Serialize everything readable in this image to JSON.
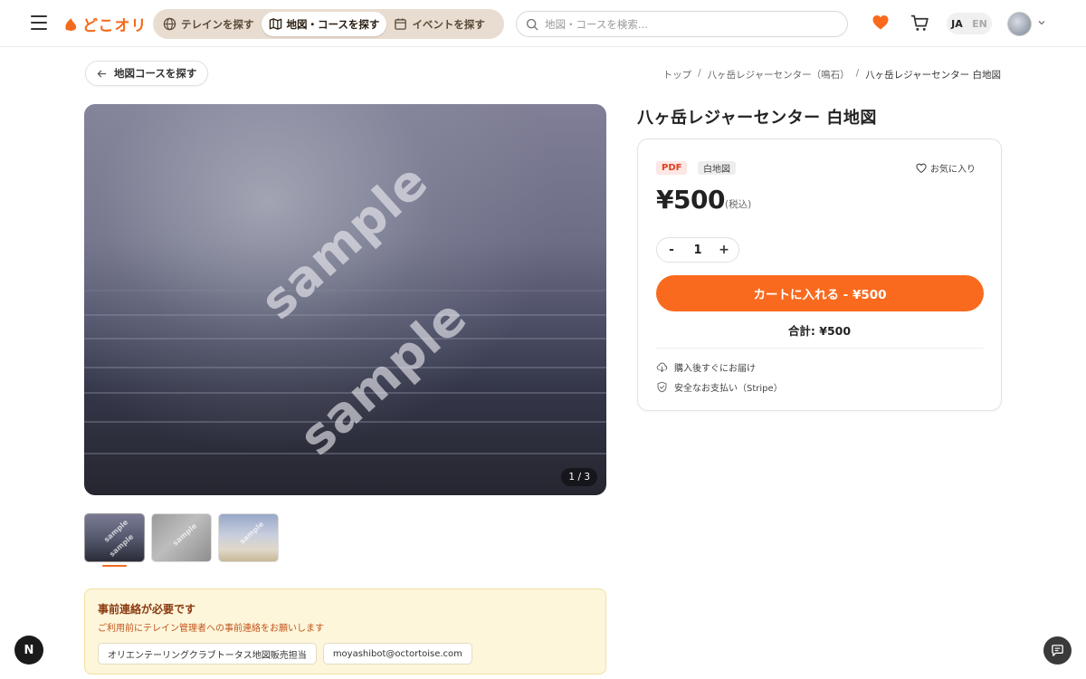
{
  "header": {
    "logo_text": "どこオリ",
    "nav_tabs": [
      {
        "label": "テレインを探す",
        "icon": "globe-icon"
      },
      {
        "label": "地図・コースを探す",
        "icon": "map-icon"
      },
      {
        "label": "イベントを探す",
        "icon": "calendar-icon"
      }
    ],
    "search_placeholder": "地図・コースを検索...",
    "lang_active": "JA",
    "lang_inactive": "EN"
  },
  "back_button": "地図コースを探す",
  "breadcrumb": {
    "items": [
      "トップ",
      "八ヶ岳レジャーセンター（鳴石）",
      "八ヶ岳レジャーセンター 白地図"
    ],
    "separator": "/"
  },
  "gallery": {
    "watermark": "sample",
    "counter": "1 / 3",
    "thumbnails": [
      "sample",
      "sample",
      "sample"
    ]
  },
  "notice": {
    "title": "事前連絡が必要です",
    "description": "ご利用前にテレイン管理者への事前連絡をお願いします",
    "contacts": [
      "オリエンテーリングクラブトータス地図販売担当",
      "moyashibot@octortoise.com"
    ]
  },
  "product": {
    "title": "八ヶ岳レジャーセンター 白地図",
    "tag_format": "PDF",
    "tag_type": "白地図",
    "favorite_label": "お気に入り",
    "price": "¥500",
    "tax_note": "(税込)",
    "qty_minus": "-",
    "quantity": "1",
    "qty_plus": "+",
    "cart_button": "カートに入れる - ¥500",
    "total": "合計: ¥500",
    "features": [
      "購入後すぐにお届け",
      "安全なお支払い（Stripe）"
    ]
  },
  "floating": {
    "left_badge": "N"
  },
  "colors": {
    "accent": "#f96a1e",
    "notice_bg": "#fdf6db",
    "pdf_tag": "#e0401f"
  }
}
